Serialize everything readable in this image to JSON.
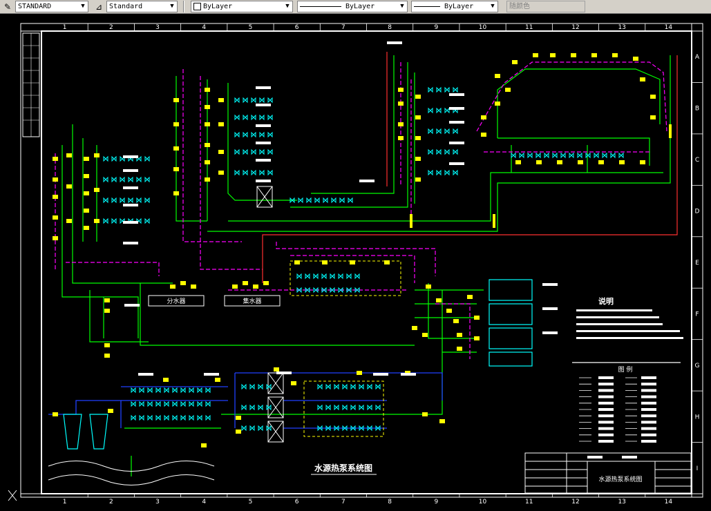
{
  "toolbar": {
    "text_style": "STANDARD",
    "dim_style": "Standard",
    "layer": "ByLayer",
    "linetype": "ByLayer",
    "lineweight": "ByLayer",
    "plot_style": "随颜色"
  },
  "drawing": {
    "col_labels": [
      "1",
      "2",
      "3",
      "4",
      "5",
      "6",
      "7",
      "8",
      "9",
      "10",
      "11",
      "12",
      "13",
      "14"
    ],
    "row_labels": [
      "A",
      "B",
      "C",
      "D",
      "E",
      "F",
      "G",
      "H",
      "I"
    ],
    "title": "水源热泵系统图",
    "block_fen": "分水器",
    "block_ji": "集水器",
    "notes_title": "说明",
    "legend_title": "图    例",
    "title_block_name": "水源热泵系统图"
  },
  "colors": {
    "green": "#00ff00",
    "magenta": "#ff00ff",
    "yellow": "#ffff00",
    "cyan": "#00ffff",
    "white": "#ffffff",
    "red": "#ff3030",
    "blue": "#2040ff"
  }
}
